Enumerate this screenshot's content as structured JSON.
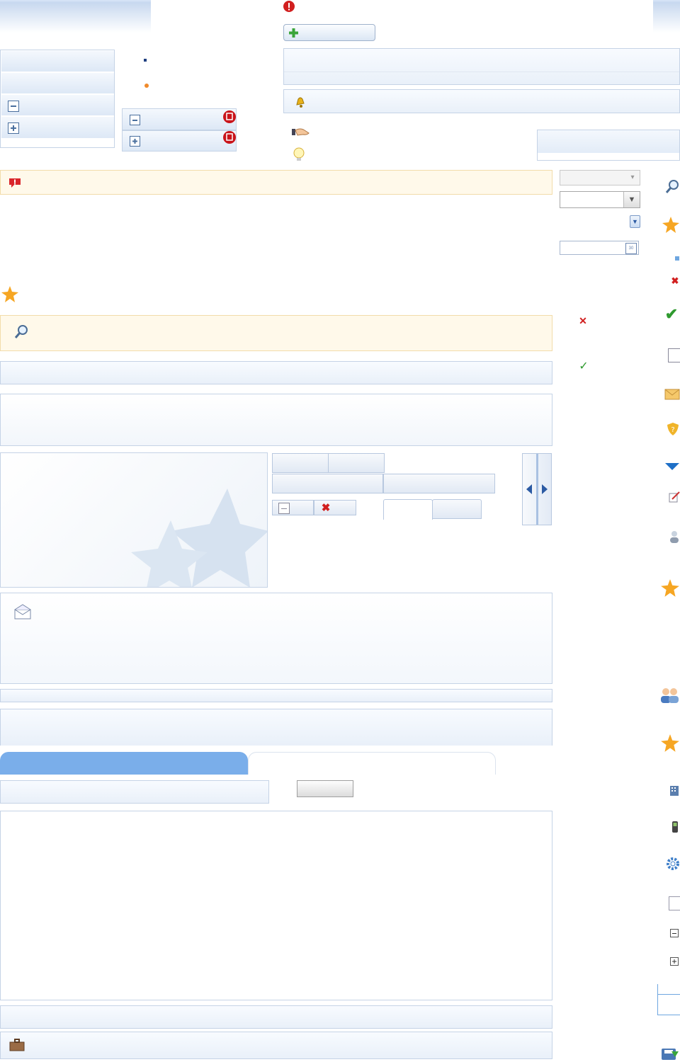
{
  "colors": {
    "accent": "#7aaeea",
    "panel_border": "#c5d3e6",
    "warning_bg": "#fff9ea",
    "error_red": "#d11f1f",
    "success_green": "#2f9a2f",
    "star_orange": "#f6a623"
  },
  "icons": [
    "error-icon",
    "add-icon",
    "collapse-icon",
    "expand-icon",
    "notebook-red-icon",
    "bell-icon",
    "handshake-icon",
    "lightbulb-icon",
    "comment-alert-icon",
    "star-icon",
    "search-icon",
    "calendar-icon",
    "delete-icon",
    "check-icon",
    "note-icon",
    "envelope-icon",
    "shield-icon",
    "triangle-down-icon",
    "edit-icon",
    "user-icon",
    "users-icon",
    "building-icon",
    "phone-icon",
    "gear-icon",
    "page-icon",
    "save-icon",
    "briefcase-icon"
  ],
  "layout": {
    "top_bar": {},
    "sidebar_tree": {
      "nodes": 4
    },
    "tabs_strip": {
      "tabs": 2,
      "active_index": 0
    }
  }
}
